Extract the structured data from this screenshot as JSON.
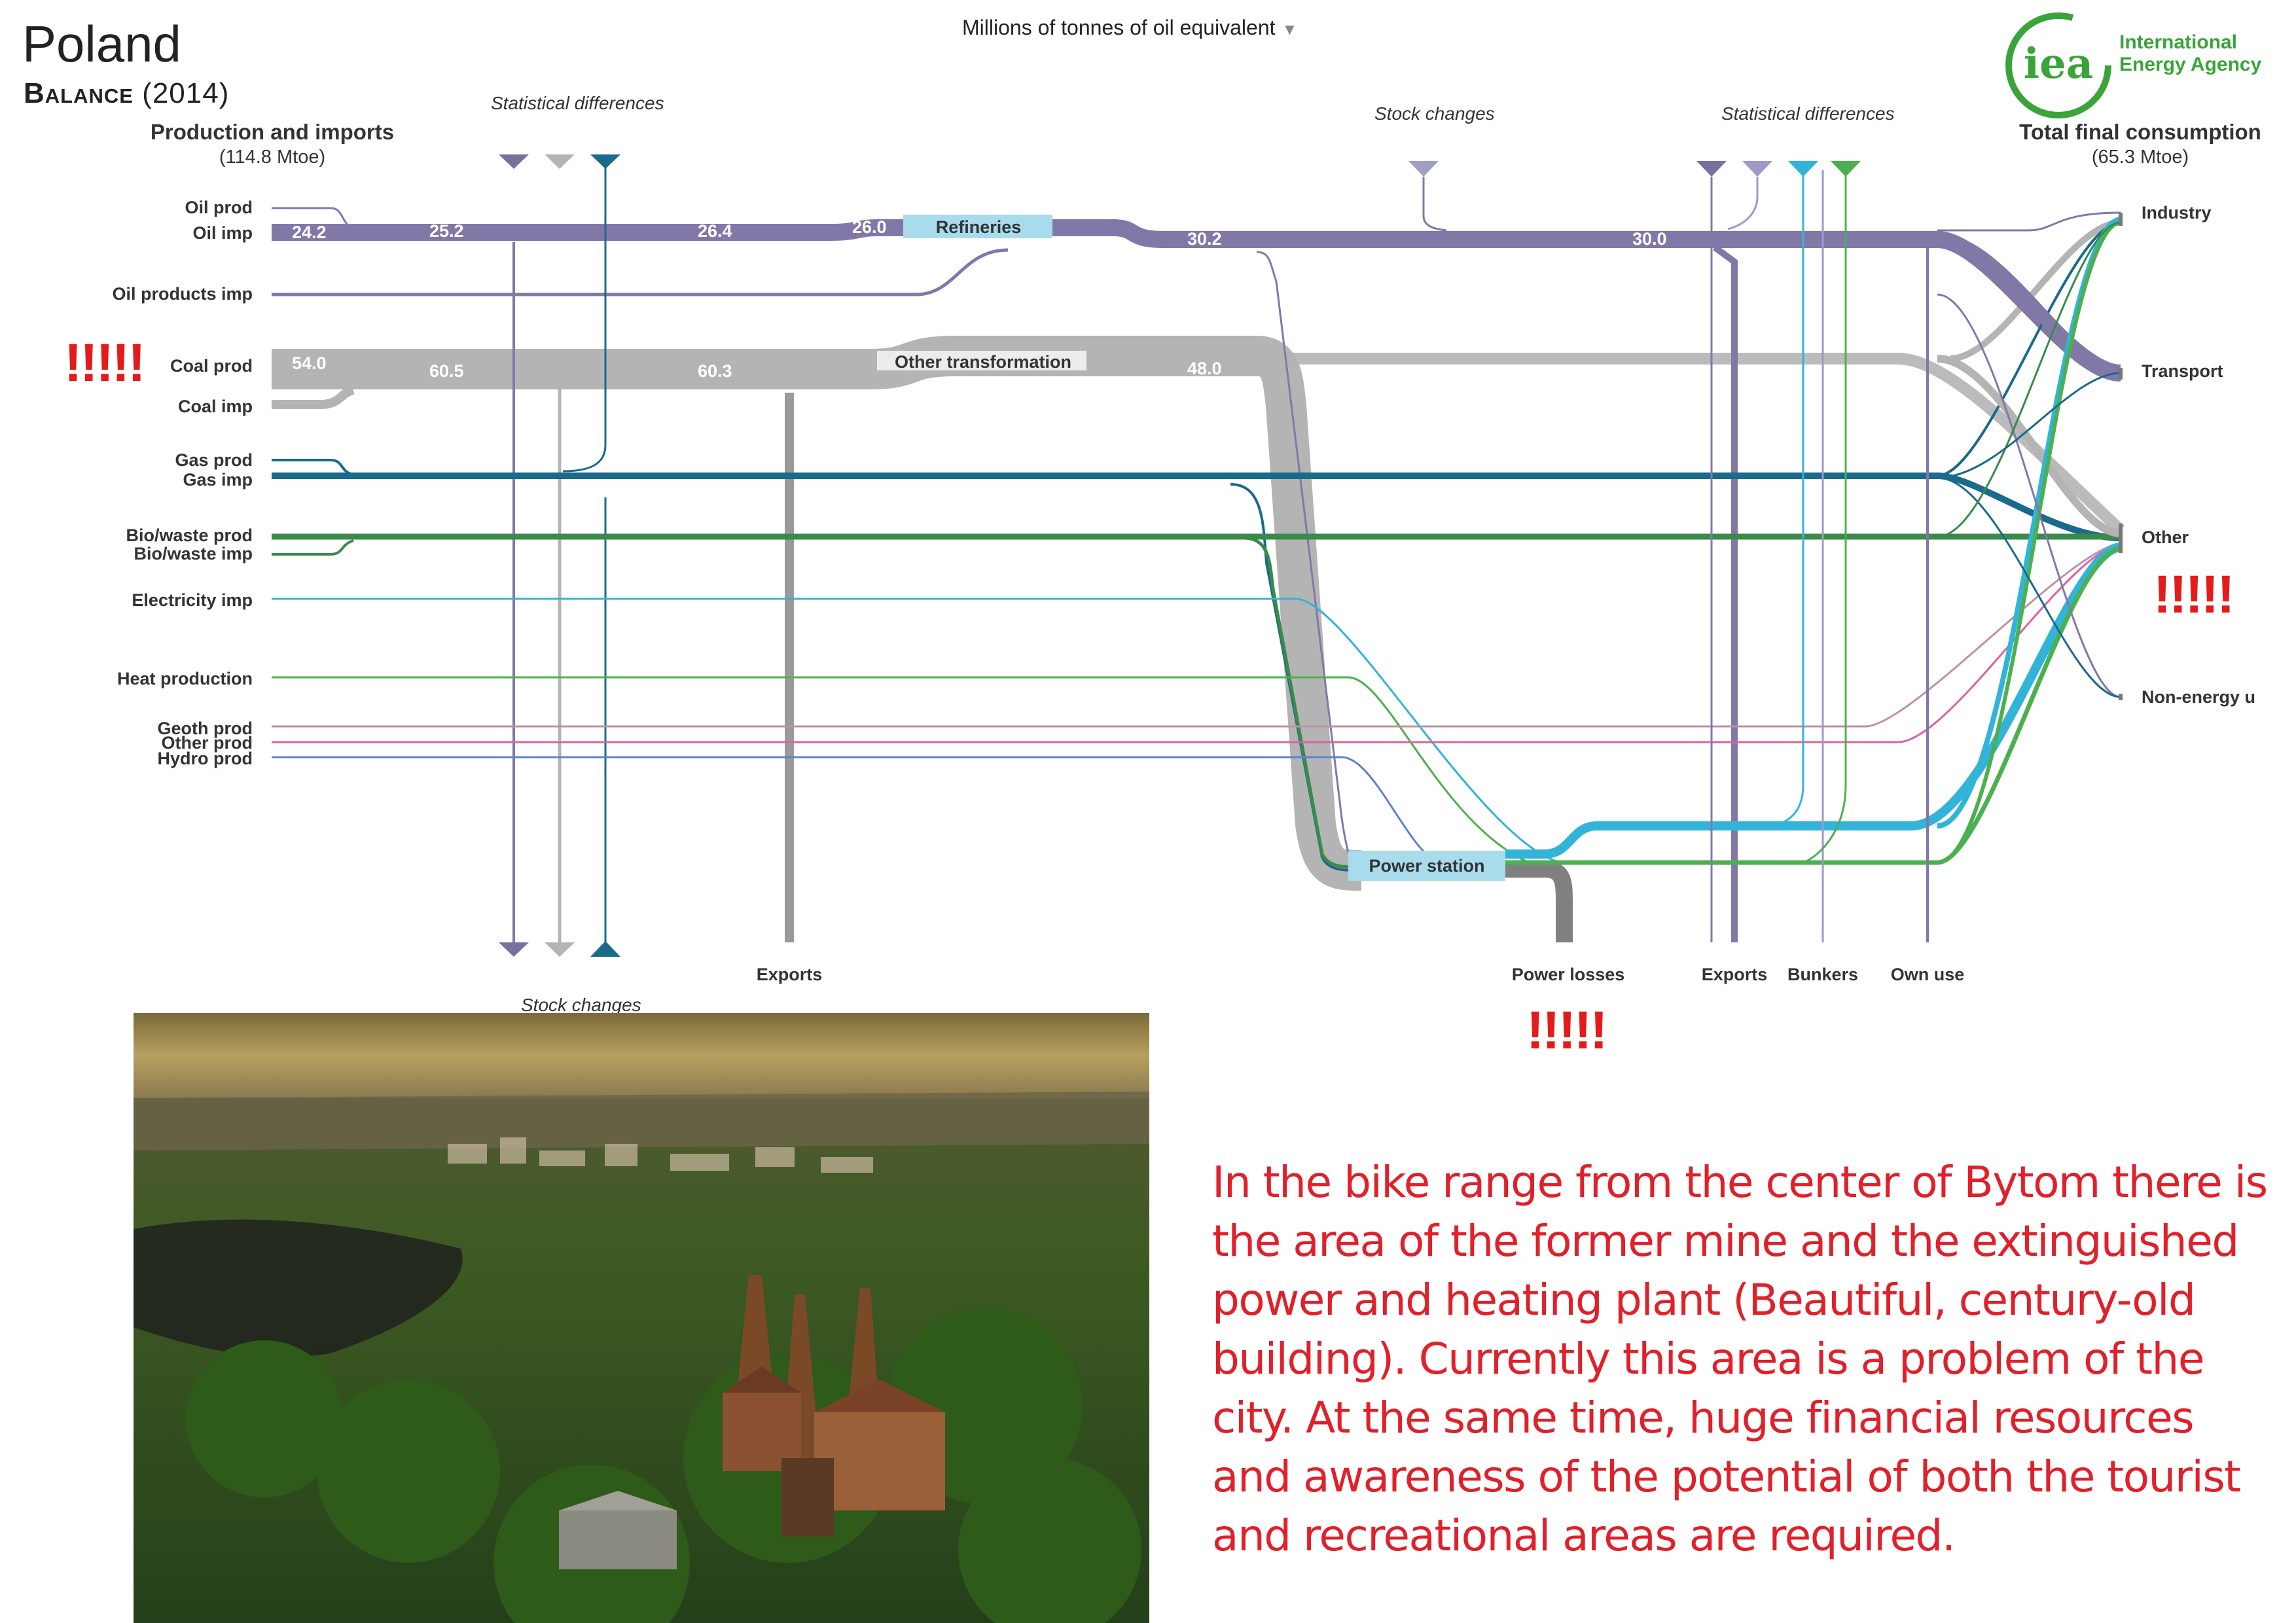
{
  "title": "Poland",
  "balance_label": "Balance",
  "balance_year": "(2014)",
  "unit_selector": "Millions of tonnes of oil equivalent",
  "left_column": {
    "heading": "Production and imports",
    "total": "(114.8 Mtoe)"
  },
  "right_column": {
    "heading": "Total final consumption",
    "total": "(65.3 Mtoe)"
  },
  "logo": {
    "mark": "iea",
    "line1": "International",
    "line2": "Energy Agency"
  },
  "annotations": {
    "stat_diff_left": "Statistical differences",
    "stat_diff_right": "Statistical differences",
    "stock_changes_top": "Stock  changes",
    "stock_changes_bottom": "Stock changes"
  },
  "sources": [
    "Oil prod",
    "Oil imp",
    "Oil products imp",
    "Coal prod",
    "Coal imp",
    "Gas prod",
    "Gas imp",
    "Bio/waste prod",
    "Bio/waste imp",
    "Electricity imp",
    "Heat production",
    "Geoth prod",
    "Other prod",
    "Hydro prod"
  ],
  "transformations": {
    "refineries": "Refineries",
    "other_transformation": "Other transformation",
    "power_station": "Power station"
  },
  "sinks": {
    "exports_left": "Exports",
    "power_losses": "Power losses",
    "exports_right": "Exports",
    "bunkers": "Bunkers",
    "own_use": "Own use"
  },
  "final_consumption": [
    "Industry",
    "Transport",
    "Other",
    "Non-energy u"
  ],
  "flow_values": {
    "oil_1": "24.2",
    "oil_2": "25.2",
    "oil_3": "26.4",
    "oil_4": "26.0",
    "oil_5": "30.2",
    "oil_6": "30.0",
    "coal_1": "54.0",
    "coal_2": "60.5",
    "coal_3": "60.3",
    "coal_4": "48.0"
  },
  "exclamations": {
    "coal": "!!!!!",
    "other": "!!!!!",
    "power_losses": "!!!!!"
  },
  "colors": {
    "oil": "#8278a8",
    "coal": "#b4b4b4",
    "gas": "#1a6a8c",
    "bio": "#3a8a4a",
    "electricity": "#32b4d8",
    "heat": "#4cb050",
    "geoth": "#c090a8",
    "other_prod": "#e060a0",
    "hydro": "#6080d0",
    "losses": "#888888",
    "accent_red": "#e41b1b"
  },
  "caption": "In the bike range from the center of Bytom there is the area of the former mine and the extinguished power and heating plant (Beautiful, century-old building). Currently this area is a problem of the city. At the same time, huge financial resources and awareness of the potential of both the tourist and recreational areas are required."
}
